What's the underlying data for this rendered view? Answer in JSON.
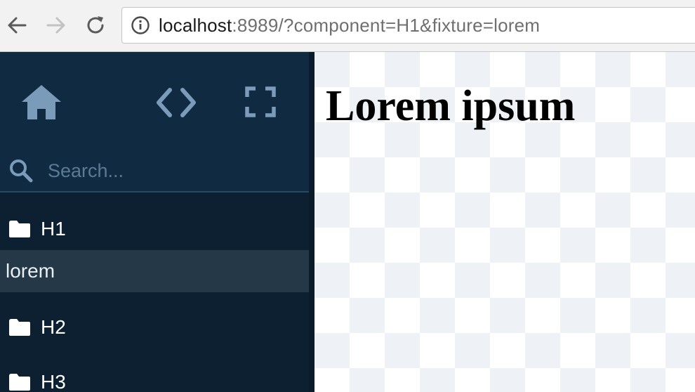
{
  "browser": {
    "url_host": "localhost",
    "url_rest": ":8989/?component=H1&fixture=lorem"
  },
  "sidebar": {
    "search": {
      "placeholder": "Search..."
    },
    "tree": [
      {
        "type": "folder",
        "label": "H1"
      },
      {
        "type": "fixture",
        "label": "lorem",
        "selected": true
      },
      {
        "type": "folder",
        "label": "H2"
      },
      {
        "type": "folder",
        "label": "H3"
      }
    ]
  },
  "preview": {
    "heading": "Lorem ipsum"
  },
  "colors": {
    "sidebar_bg": "#0c2032",
    "sidebar_header_bg": "#0f2a41",
    "icon_color": "#7a9bba",
    "selected_bg": "#253848"
  }
}
